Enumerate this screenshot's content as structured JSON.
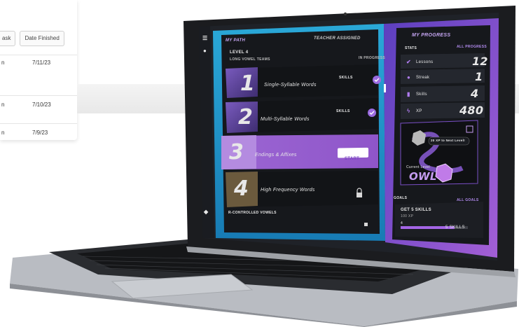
{
  "bg_table": {
    "col_task": "ask",
    "col_date": "Date Finished",
    "rows": [
      {
        "left": "n",
        "date": "7/11/23"
      },
      {
        "left": "n",
        "date": "7/10/23"
      },
      {
        "left": "n",
        "date": "7/9/23"
      }
    ]
  },
  "path": {
    "title": "MY PATH",
    "teacher": "TEACHER ASSIGNED",
    "level": "LEVEL 4",
    "unit": "LONG VOWEL TEAMS",
    "status": "IN PROGRESS",
    "lessons": [
      {
        "num": "1",
        "name": "Single-Syllable Words",
        "tag": "SKILLS"
      },
      {
        "num": "2",
        "name": "Multi-Syllable Words",
        "tag": "SKILLS"
      },
      {
        "num": "3",
        "name": "Endings & Affixes",
        "action": "START"
      },
      {
        "num": "4",
        "name": "High Frequency Words"
      }
    ],
    "next_unit": "R-CONTROLLED VOWELS"
  },
  "progress": {
    "title": "MY PROGRESS",
    "stats_label": "STATS",
    "all_label": "ALL PROGRESS",
    "stats": [
      {
        "label": "Lessons",
        "value": "12",
        "icon": "check-icon"
      },
      {
        "label": "Streak",
        "value": "1",
        "icon": "flame-icon"
      },
      {
        "label": "Skills",
        "value": "4",
        "icon": "bookmark-icon"
      },
      {
        "label": "XP",
        "value": "480",
        "icon": "bolt-icon"
      }
    ],
    "next_level": "20 XP to Next Level!",
    "current_level_label": "Current Level",
    "current_level": "OWL",
    "goals_label": "GOALS",
    "all_goals": "ALL GOALS",
    "goal_title": "GET 5 SKILLS",
    "goal_xp": "100 XP",
    "goal_count": "4",
    "goal_target": "5 SKILLS",
    "goal_fraction": 0.8
  }
}
